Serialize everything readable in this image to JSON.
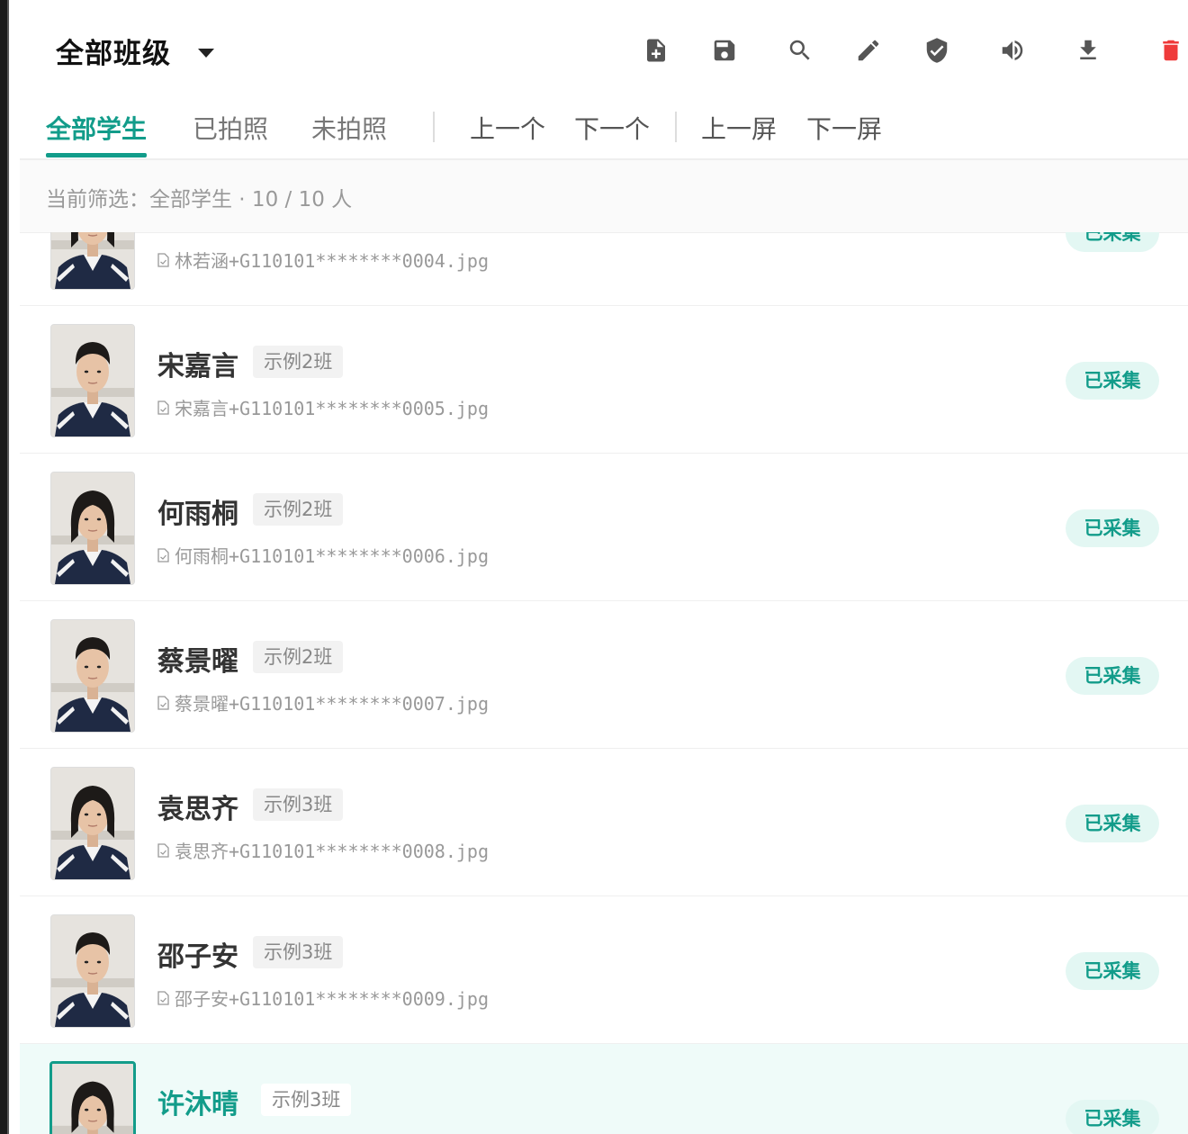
{
  "header": {
    "class_select": "全部班级",
    "toolbar_icons": [
      "file-add-icon",
      "save-icon",
      "search-icon",
      "pencil-icon",
      "shield-check-icon",
      "volume-icon",
      "download-icon",
      "trash-icon"
    ]
  },
  "tabs": [
    {
      "label": "全部学生",
      "active": true
    },
    {
      "label": "已拍照",
      "active": false
    },
    {
      "label": "未拍照",
      "active": false
    }
  ],
  "nav": {
    "prev_item": "上一个",
    "next_item": "下一个",
    "prev_screen": "上一屏",
    "next_screen": "下一屏"
  },
  "filter_text": "当前筛选：全部学生 · 10 / 10 人",
  "students": [
    {
      "name": "林若涵",
      "class": "",
      "file": "林若涵+G110101********0004.jpg",
      "status": "已采集",
      "gender": "female"
    },
    {
      "name": "宋嘉言",
      "class": "示例2班",
      "file": "宋嘉言+G110101********0005.jpg",
      "status": "已采集",
      "gender": "male"
    },
    {
      "name": "何雨桐",
      "class": "示例2班",
      "file": "何雨桐+G110101********0006.jpg",
      "status": "已采集",
      "gender": "female"
    },
    {
      "name": "蔡景曜",
      "class": "示例2班",
      "file": "蔡景曜+G110101********0007.jpg",
      "status": "已采集",
      "gender": "male"
    },
    {
      "name": "袁思齐",
      "class": "示例3班",
      "file": "袁思齐+G110101********0008.jpg",
      "status": "已采集",
      "gender": "female"
    },
    {
      "name": "邵子安",
      "class": "示例3班",
      "file": "邵子安+G110101********0009.jpg",
      "status": "已采集",
      "gender": "male"
    },
    {
      "name": "许沐晴",
      "class": "示例3班",
      "file": "",
      "status": "已采集",
      "gender": "female",
      "selected": true
    }
  ],
  "colors": {
    "accent": "#129c8a",
    "status_bg": "#e3f7f3",
    "danger": "#ef3b3b",
    "selected_row": "#effbf9"
  }
}
